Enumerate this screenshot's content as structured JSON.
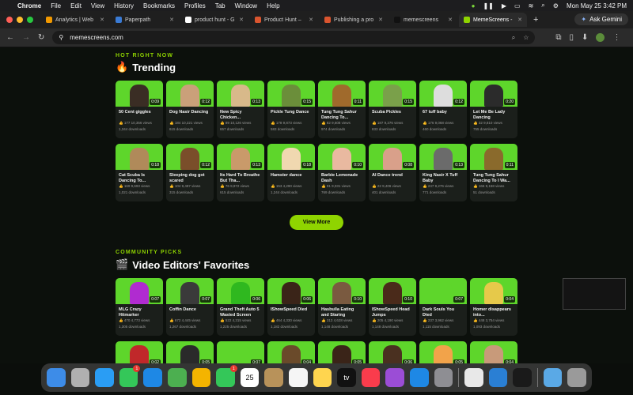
{
  "menubar": {
    "app": "Chrome",
    "items": [
      "File",
      "Edit",
      "View",
      "History",
      "Bookmarks",
      "Profiles",
      "Tab",
      "Window",
      "Help"
    ],
    "datetime": "Mon May 25  3:42 PM"
  },
  "tabs": [
    {
      "label": "Analytics | Web",
      "color": "#f29900"
    },
    {
      "label": "Paperpath",
      "color": "#3a7bd5"
    },
    {
      "label": "product hunt - G",
      "color": "#ffffff"
    },
    {
      "label": "Product Hunt –",
      "color": "#da552f"
    },
    {
      "label": "Publishing a pro",
      "color": "#da552f"
    },
    {
      "label": "memescreens",
      "color": "#111111"
    },
    {
      "label": "MemeScreens -",
      "color": "#8fd400",
      "active": true
    }
  ],
  "ask_gemini": "Ask Gemini",
  "address": "memescreens.com",
  "trending": {
    "kicker": "HOT RIGHT NOW",
    "title": "Trending",
    "title_icon": "fire-icon",
    "cards": [
      {
        "title": "50 Cent giggles",
        "duration": "0:09",
        "likes": "177",
        "views": "10,356 views",
        "downloads": "1,344 downloads",
        "fig": "#3a2d24"
      },
      {
        "title": "Dog Nasir Dancing",
        "duration": "0:12",
        "likes": "184",
        "views": "10,221 views",
        "downloads": "615 downloads",
        "fig": "#caa07a"
      },
      {
        "title": "New Spicy Chicken...",
        "duration": "0:13",
        "likes": "89",
        "views": "10,126 views",
        "downloads": "657 downloads",
        "fig": "#d8b98a"
      },
      {
        "title": "Pickle Tung Dance",
        "duration": "0:15",
        "likes": "178",
        "views": "9,873 views",
        "downloads": "583 downloads",
        "fig": "#6b8e3a"
      },
      {
        "title": "Tung Tung Sahur Dancing To...",
        "duration": "0:11",
        "likes": "82",
        "views": "9,608 views",
        "downloads": "974 downloads",
        "fig": "#a06a2c"
      },
      {
        "title": "Scuba Pickles",
        "duration": "0:15",
        "likes": "187",
        "views": "9,376 views",
        "downloads": "833 downloads",
        "fig": "#7aa04a"
      },
      {
        "title": "67 tuff baby",
        "duration": "0:12",
        "likes": "176",
        "views": "9,068 views",
        "downloads": "460 downloads",
        "fig": "#dddddd"
      },
      {
        "title": "Let Me Be Lady Dancing",
        "duration": "0:20",
        "likes": "32",
        "views": "9,810 views",
        "downloads": "755 downloads",
        "fig": "#2b2b2b"
      },
      {
        "title": "Cat Scuba Is Dancing To...",
        "duration": "0:18",
        "likes": "169",
        "views": "9,693 views",
        "downloads": "1,021 downloads",
        "fig": "#b08a5a"
      },
      {
        "title": "Sleeping dog got scared",
        "duration": "0:12",
        "likes": "104",
        "views": "9,487 views",
        "downloads": "315 downloads",
        "fig": "#7a4e2a"
      },
      {
        "title": "Its Hard To Breathe But Tha...",
        "duration": "0:13",
        "likes": "76",
        "views": "9,972 views",
        "downloads": "615 downloads",
        "fig": "#c99a6a"
      },
      {
        "title": "Hamster dance",
        "duration": "0:18",
        "likes": "153",
        "views": "4,290 views",
        "downloads": "1,244 downloads",
        "fig": "#f0d8b0"
      },
      {
        "title": "Barbie Lemonade Dash",
        "duration": "0:10",
        "likes": "91",
        "views": "9,031 views",
        "downloads": "769 downloads",
        "fig": "#e9b9a0"
      },
      {
        "title": "AI Dance trend",
        "duration": "0:08",
        "likes": "22",
        "views": "9,406 views",
        "downloads": "401 downloads",
        "fig": "#d9a08a"
      },
      {
        "title": "King Nasir X Tuff Baby",
        "duration": "0:13",
        "likes": "247",
        "views": "9,276 views",
        "downloads": "771 downloads",
        "fig": "#6b6b6b"
      },
      {
        "title": "Tung Tung Sahur Dancing To I Wa...",
        "duration": "0:11",
        "likes": "166",
        "views": "9,158 views",
        "downloads": "51 downloads",
        "fig": "#8a6a2c"
      }
    ]
  },
  "view_more": "View More",
  "picks": {
    "kicker": "COMMUNITY PICKS",
    "title": "Video Editors' Favorites",
    "title_icon": "clapper-icon",
    "cards": [
      {
        "title": "MLG Crazy Hitmarker",
        "duration": "0:07",
        "likes": "470",
        "views": "4,773 views",
        "downloads": "1,305 downloads",
        "fig": "#b02bd0"
      },
      {
        "title": "Coffin Dance",
        "duration": "0:07",
        "likes": "672",
        "views": "4,445 views",
        "downloads": "1,267 downloads",
        "fig": "#3a3a3a"
      },
      {
        "title": "Grand Theft Auto 5 Wasted Screen",
        "duration": "0:06",
        "likes": "522",
        "views": "4,315 views",
        "downloads": "1,225 downloads",
        "fig": "#2fb81f"
      },
      {
        "title": "IShowSpeed Died",
        "duration": "0:06",
        "likes": "464",
        "views": "4,330 views",
        "downloads": "1,182 downloads",
        "fig": "#3a2418"
      },
      {
        "title": "Hasbulla Eating and Staring",
        "duration": "0:10",
        "likes": "313",
        "views": "4,628 views",
        "downloads": "1,148 downloads",
        "fig": "#7a5a40"
      },
      {
        "title": "IShowSpeed Head Jumps",
        "duration": "0:10",
        "likes": "205",
        "views": "4,190 views",
        "downloads": "1,148 downloads",
        "fig": "#4a2a1a"
      },
      {
        "title": "Dark Souls You Died",
        "duration": "0:07",
        "likes": "237",
        "views": "3,962 views",
        "downloads": "1,115 downloads",
        "fig": "#5ed62b"
      },
      {
        "title": "Homer disappears into...",
        "duration": "0:04",
        "likes": "448",
        "views": "3,754 views",
        "downloads": "1,093 downloads",
        "fig": "#e6c94a"
      },
      {
        "title": "",
        "duration": "0:02",
        "likes": "",
        "views": "",
        "downloads": "",
        "fig": "#c0282a"
      },
      {
        "title": "",
        "duration": "0:05",
        "likes": "",
        "views": "",
        "downloads": "",
        "fig": "#2a2a2a"
      },
      {
        "title": "",
        "duration": "0:07",
        "likes": "",
        "views": "",
        "downloads": "",
        "fig": "#5ed62b"
      },
      {
        "title": "",
        "duration": "0:04",
        "likes": "",
        "views": "",
        "downloads": "",
        "fig": "#6a4a2a"
      },
      {
        "title": "",
        "duration": "0:05",
        "likes": "",
        "views": "",
        "downloads": "",
        "fig": "#3a2418"
      },
      {
        "title": "",
        "duration": "0:06",
        "likes": "",
        "views": "",
        "downloads": "",
        "fig": "#4a3020"
      },
      {
        "title": "",
        "duration": "0:05",
        "likes": "",
        "views": "",
        "downloads": "",
        "fig": "#f2a34a"
      },
      {
        "title": "",
        "duration": "0:04",
        "likes": "",
        "views": "",
        "downloads": "",
        "fig": "#c89a7a"
      }
    ]
  },
  "dock": [
    {
      "name": "finder-icon",
      "color": "#3d8ce8"
    },
    {
      "name": "launchpad-icon",
      "color": "#b0b0b0"
    },
    {
      "name": "safari-icon",
      "color": "#2a9df4"
    },
    {
      "name": "messages-icon",
      "color": "#34c759",
      "badge": "1"
    },
    {
      "name": "mail-icon",
      "color": "#1e88e5"
    },
    {
      "name": "maps-icon",
      "color": "#4caf50"
    },
    {
      "name": "photos-icon",
      "color": "#f4b400"
    },
    {
      "name": "facetime-icon",
      "color": "#34c759",
      "badge": "1"
    },
    {
      "name": "calendar-icon",
      "color": "#ffffff",
      "label": "25"
    },
    {
      "name": "contacts-icon",
      "color": "#b8925a"
    },
    {
      "name": "reminders-icon",
      "color": "#f5f5f5"
    },
    {
      "name": "notes-icon",
      "color": "#ffd54f"
    },
    {
      "name": "appletv-icon",
      "color": "#111111",
      "label": "tv"
    },
    {
      "name": "music-icon",
      "color": "#fa3c4c"
    },
    {
      "name": "podcasts-icon",
      "color": "#9b4dd6"
    },
    {
      "name": "appstore-icon",
      "color": "#1e88e5"
    },
    {
      "name": "settings-icon",
      "color": "#8e8e93"
    },
    {
      "name": "chrome-icon",
      "color": "#e8e8e8"
    },
    {
      "name": "vscode-icon",
      "color": "#2a7fd4"
    },
    {
      "name": "terminal-icon",
      "color": "#1a1a1a"
    },
    {
      "name": "folder-icon",
      "color": "#5aa9e6"
    },
    {
      "name": "trash-icon",
      "color": "#9a9a9a"
    }
  ]
}
